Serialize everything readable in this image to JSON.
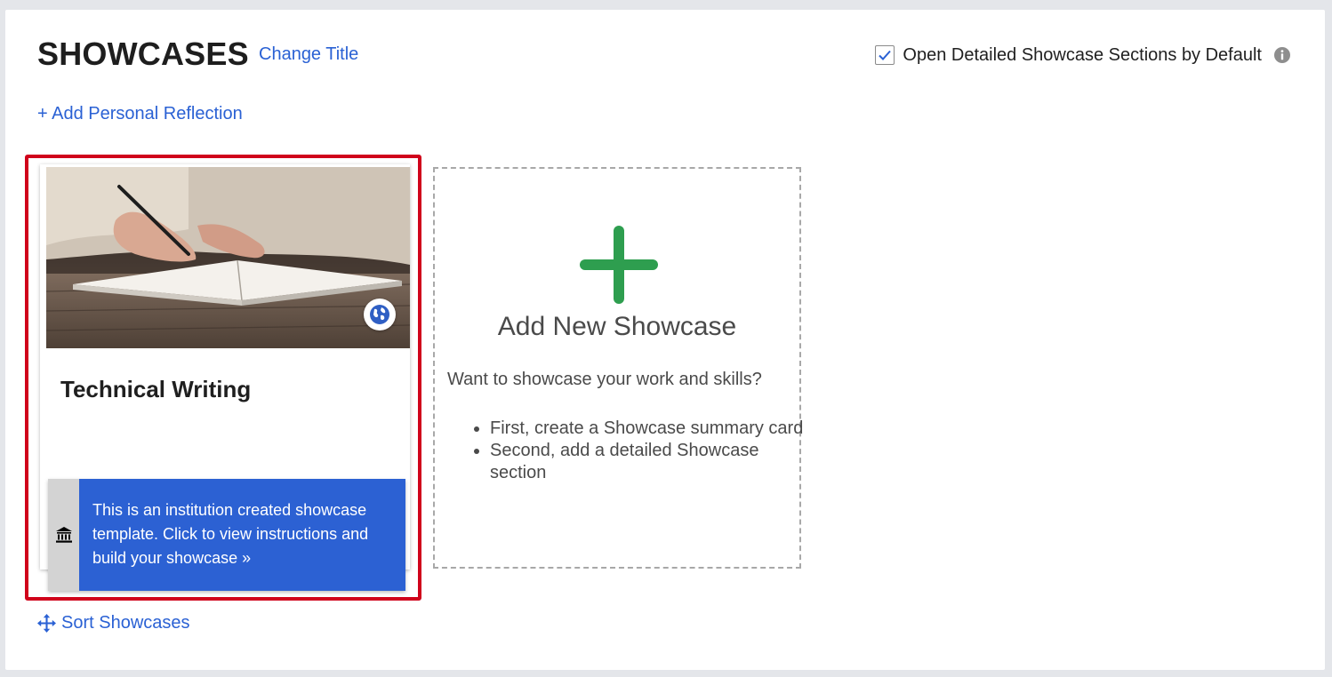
{
  "header": {
    "title": "SHOWCASES",
    "change_title_label": "Change Title",
    "default_open_label": "Open Detailed Showcase Sections by Default",
    "default_open_checked": true
  },
  "actions": {
    "add_reflection_label": "+ Add Personal Reflection",
    "sort_label": "Sort Showcases"
  },
  "showcase_card": {
    "title": "Technical Writing",
    "visibility_icon": "globe-icon",
    "template_icon": "institution-icon",
    "template_notice": "This is an institution created showcase template. Click to view instructions and build your showcase",
    "template_notice_arrow": "»"
  },
  "add_card": {
    "title": "Add New Showcase",
    "description": "Want to showcase your work and skills?",
    "steps": [
      "First, create a Showcase summary card",
      "Second, add a detailed Showcase section"
    ]
  },
  "colors": {
    "accent": "#2a61d4",
    "banner": "#2c61d3",
    "plus": "#2e9e4f",
    "highlight": "#d0021b"
  }
}
